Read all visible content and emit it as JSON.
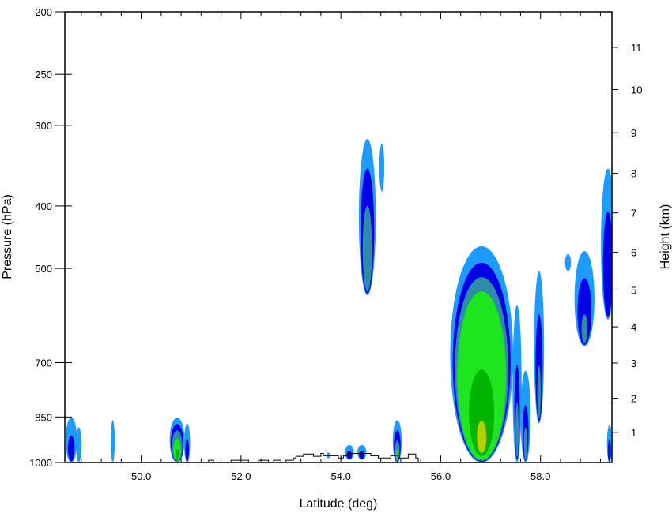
{
  "chart_data": {
    "type": "contour",
    "xlabel": "Latitude (deg)",
    "ylabel": "Pressure (hPa)",
    "y2label": "Height (km)",
    "xlim": [
      48.47,
      59.43
    ],
    "ylim": [
      1000,
      200
    ],
    "yscale": "log",
    "x_ticks": [
      50.0,
      52.0,
      54.0,
      56.0,
      58.0
    ],
    "x_tick_labels": [
      "50.0",
      "52.0",
      "54.0",
      "56.0",
      "58.0"
    ],
    "y_ticks": [
      200,
      250,
      300,
      400,
      500,
      700,
      850,
      1000
    ],
    "y_tick_labels": [
      "200",
      "250",
      "300",
      "400",
      "500",
      "700",
      "850",
      "1000"
    ],
    "y2_ticks": [
      1,
      2,
      3,
      4,
      5,
      6,
      7,
      8,
      9,
      10,
      11
    ],
    "y2_tick_labels": [
      "1",
      "2",
      "3",
      "4",
      "5",
      "6",
      "7",
      "8",
      "9",
      "10",
      "11"
    ],
    "y2_pressure_hpa": [
      898,
      795,
      701,
      616,
      540,
      472,
      410,
      356,
      308,
      264,
      227
    ],
    "level_colors": [
      "#1e9bff",
      "#0000e6",
      "#2d8caa",
      "#1ee61e",
      "#00b400",
      "#b4d200"
    ],
    "cells": [
      {
        "lat": 48.6,
        "bot": 1000,
        "top": 845,
        "halfwidth": 0.12,
        "levels": [
          0.95,
          0.55
        ]
      },
      {
        "lat": 48.75,
        "bot": 1000,
        "top": 870,
        "halfwidth": 0.06,
        "levels": [
          0.9
        ]
      },
      {
        "lat": 49.43,
        "bot": 1000,
        "top": 860,
        "halfwidth": 0.04,
        "levels": [
          1
        ]
      },
      {
        "lat": 50.72,
        "bot": 1000,
        "top": 852,
        "halfwidth": 0.15,
        "levels": [
          1,
          0.85,
          0.7,
          0.5,
          0.25
        ]
      },
      {
        "lat": 50.92,
        "bot": 1000,
        "top": 870,
        "halfwidth": 0.06,
        "levels": [
          1,
          0.6
        ]
      },
      {
        "lat": 53.75,
        "bot": 985,
        "top": 965,
        "halfwidth": 0.04,
        "levels": [
          1
        ]
      },
      {
        "lat": 54.17,
        "bot": 990,
        "top": 940,
        "halfwidth": 0.09,
        "levels": [
          1,
          0.6
        ]
      },
      {
        "lat": 54.42,
        "bot": 990,
        "top": 940,
        "halfwidth": 0.09,
        "levels": [
          1,
          0.6
        ]
      },
      {
        "lat": 54.53,
        "bot": 550,
        "top": 315,
        "halfwidth": 0.17,
        "levels": [
          1,
          0.8,
          0.55
        ]
      },
      {
        "lat": 54.82,
        "bot": 380,
        "top": 320,
        "halfwidth": 0.05,
        "levels": [
          1
        ]
      },
      {
        "lat": 55.13,
        "bot": 1000,
        "top": 860,
        "halfwidth": 0.09,
        "levels": [
          1,
          0.75,
          0.5,
          0.3
        ]
      },
      {
        "lat": 56.82,
        "bot": 1000,
        "top": 462,
        "halfwidth": 0.63,
        "levels": [
          1,
          0.92,
          0.85,
          0.78,
          0.4,
          0.15
        ]
      },
      {
        "lat": 57.53,
        "bot": 1000,
        "top": 570,
        "halfwidth": 0.09,
        "levels": [
          1,
          0.6,
          0.35
        ]
      },
      {
        "lat": 57.7,
        "bot": 1000,
        "top": 720,
        "halfwidth": 0.1,
        "levels": [
          1,
          0.6,
          0.35
        ]
      },
      {
        "lat": 57.97,
        "bot": 870,
        "top": 505,
        "halfwidth": 0.1,
        "levels": [
          1,
          0.7,
          0.35
        ]
      },
      {
        "lat": 58.55,
        "bot": 505,
        "top": 475,
        "halfwidth": 0.06,
        "levels": [
          1
        ]
      },
      {
        "lat": 58.88,
        "bot": 660,
        "top": 470,
        "halfwidth": 0.2,
        "levels": [
          1,
          0.7,
          0.3
        ]
      },
      {
        "lat": 59.35,
        "bot": 600,
        "top": 350,
        "halfwidth": 0.14,
        "levels": [
          1,
          0.7
        ]
      },
      {
        "lat": 59.38,
        "bot": 1000,
        "top": 875,
        "halfwidth": 0.05,
        "levels": [
          1,
          0.6
        ]
      }
    ],
    "terrain_steps": [
      [
        48.47,
        1000
      ],
      [
        51.35,
        1000
      ],
      [
        51.35,
        992
      ],
      [
        51.45,
        992
      ],
      [
        51.45,
        1000
      ],
      [
        51.8,
        1000
      ],
      [
        51.8,
        992
      ],
      [
        52.15,
        992
      ],
      [
        52.15,
        1000
      ],
      [
        52.35,
        1000
      ],
      [
        52.35,
        992
      ],
      [
        52.55,
        992
      ],
      [
        52.55,
        1000
      ],
      [
        52.65,
        1000
      ],
      [
        52.65,
        992
      ],
      [
        52.8,
        992
      ],
      [
        52.8,
        1000
      ],
      [
        52.9,
        1000
      ],
      [
        52.9,
        992
      ],
      [
        53.05,
        992
      ],
      [
        53.05,
        984
      ],
      [
        53.1,
        984
      ],
      [
        53.1,
        978
      ],
      [
        53.25,
        978
      ],
      [
        53.25,
        970
      ],
      [
        53.45,
        970
      ],
      [
        53.45,
        978
      ],
      [
        53.6,
        978
      ],
      [
        53.6,
        968
      ],
      [
        53.65,
        968
      ],
      [
        53.65,
        976
      ],
      [
        53.95,
        976
      ],
      [
        53.95,
        984
      ],
      [
        54.05,
        984
      ],
      [
        54.05,
        976
      ],
      [
        54.15,
        976
      ],
      [
        54.15,
        968
      ],
      [
        54.6,
        968
      ],
      [
        54.6,
        976
      ],
      [
        54.75,
        976
      ],
      [
        54.75,
        984
      ],
      [
        55.0,
        984
      ],
      [
        55.0,
        976
      ],
      [
        55.15,
        976
      ],
      [
        55.15,
        984
      ],
      [
        55.35,
        984
      ],
      [
        55.35,
        970
      ],
      [
        55.5,
        970
      ],
      [
        55.5,
        984
      ],
      [
        55.55,
        984
      ],
      [
        55.55,
        1000
      ],
      [
        59.43,
        1000
      ]
    ]
  }
}
